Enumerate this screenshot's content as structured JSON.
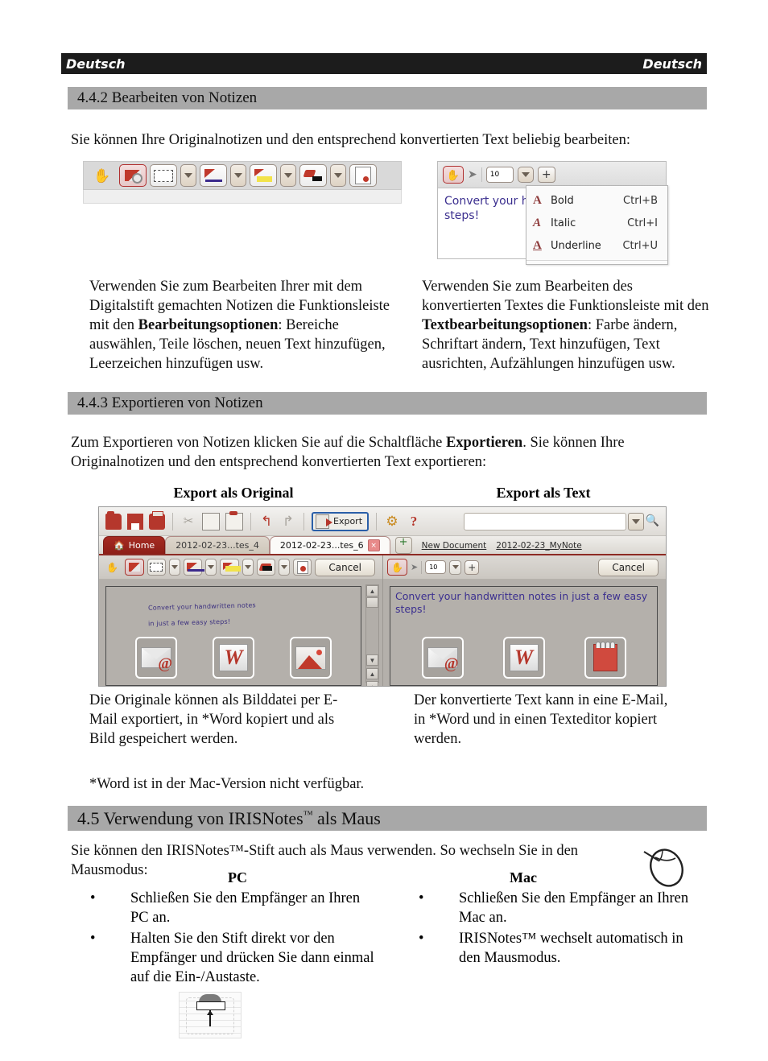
{
  "header": {
    "left": "Deutsch",
    "right": "Deutsch"
  },
  "sections": {
    "s442": {
      "heading": "4.4.2 Bearbeiten von Notizen"
    },
    "s443": {
      "heading": "4.4.3 Exportieren von Notizen"
    },
    "s45": {
      "heading_pre": "4.5 Verwendung von IRISNotes",
      "heading_tm": "™",
      "heading_post": " als Maus"
    }
  },
  "body": {
    "intro_442": "Sie können Ihre Originalnotizen und den entsprechend konvertierten Text beliebig bearbeiten:",
    "left_442": {
      "part1": "Verwenden Sie zum Bearbeiten Ihrer mit dem Digitalstift gemachten Notizen die Funktionsleiste mit den ",
      "bold": "Bearbeitungsoptionen",
      "part2": ": Bereiche auswählen, Teile löschen, neuen Text hinzufügen, Leerzeichen hinzufügen usw."
    },
    "right_442": {
      "part1": "Verwenden Sie zum Bearbeiten des konvertierten Textes die Funktionsleiste mit den ",
      "bold": "Textbearbeitungsoptionen",
      "part2": ": Farbe ändern, Schriftart ändern, Text hinzufügen, Text ausrichten, Aufzählungen hinzufügen usw."
    },
    "intro_443": {
      "part1": "Zum Exportieren von Notizen klicken Sie auf die Schaltfläche ",
      "bold": "Exportieren",
      "part2": ". Sie können Ihre Originalnotizen und den entsprechend konvertierten Text exportieren:"
    },
    "caption_left": "Export als Original",
    "caption_right": "Export als Text",
    "left_443": "Die Originale können als Bilddatei per E-Mail exportiert, in *Word kopiert und als Bild gespeichert werden.",
    "footnote_443": "*Word ist in der Mac-Version nicht verfügbar.",
    "right_443": "Der konvertierte Text kann in eine E-Mail, in *Word und in einen Texteditor kopiert werden.",
    "intro_45": "Sie können den IRISNotes™-Stift auch als Maus verwenden. So wechseln Sie in den Mausmodus:"
  },
  "columns": {
    "pc": {
      "title": "PC",
      "bullet_char": "•",
      "items": [
        "Schließen Sie den Empfänger an Ihren PC an.",
        "Halten Sie den Stift direkt vor den Empfänger und drücken Sie dann einmal auf die Ein-/Austaste."
      ]
    },
    "mac": {
      "title": "Mac",
      "bullet_char": "•",
      "items": [
        "Schließen Sie den Empfänger an Ihren Mac an.",
        "IRISNotes™ wechselt automatisch in den Mausmodus."
      ]
    }
  },
  "figures": {
    "edit_toolbar": {
      "buttons": [
        {
          "icon": "hand-icon",
          "label": ""
        },
        {
          "icon": "settings-area-icon",
          "label": ""
        },
        {
          "icon": "select-rect-icon",
          "label": ""
        },
        {
          "icon": "dropdown-caret-icon",
          "label": ""
        },
        {
          "icon": "pen-icon",
          "label": ""
        },
        {
          "icon": "dropdown-caret-icon",
          "label": ""
        },
        {
          "icon": "highlighter-icon",
          "label": ""
        },
        {
          "icon": "dropdown-caret-icon",
          "label": ""
        },
        {
          "icon": "eraser-icon",
          "label": ""
        },
        {
          "icon": "dropdown-caret-icon",
          "label": ""
        },
        {
          "icon": "note-edit-icon",
          "label": ""
        }
      ]
    },
    "text_toolbar": {
      "font_size_value": "10",
      "plus_label": "+",
      "sample_text_line1": "Convert your h",
      "sample_text_line2": "steps!",
      "menu": [
        {
          "glyph": "A",
          "label": "Bold",
          "shortcut": "Ctrl+B"
        },
        {
          "glyph": "A",
          "label": "Italic",
          "shortcut": "Ctrl+I"
        },
        {
          "glyph": "A",
          "label": "Underline",
          "shortcut": "Ctrl+U"
        }
      ]
    },
    "app": {
      "toolbar": {
        "export_label": "Export",
        "icons": [
          "open-folder-icon",
          "save-icon",
          "print-icon",
          "cut-icon",
          "copy-icon",
          "paste-icon",
          "undo-icon",
          "redo-icon",
          "settings-gear-icon",
          "help-icon"
        ]
      },
      "tabs": [
        {
          "label": "Home",
          "state": "home"
        },
        {
          "label": "2012-02-23...tes_4",
          "state": "inactive"
        },
        {
          "label": "2012-02-23...tes_6",
          "state": "active",
          "close": "×"
        }
      ],
      "search": {
        "value": "",
        "placeholder": ""
      },
      "doc_links": [
        "New Document",
        "2012-02-23_MyNote"
      ],
      "left_panel": {
        "cancel_label": "Cancel",
        "handwriting_line1": "Convert your handwritten notes",
        "handwriting_line2": "in just a few easy steps!",
        "export_icons": [
          "email-export-icon",
          "word-export-icon",
          "image-export-icon"
        ]
      },
      "right_panel": {
        "cancel_label": "Cancel",
        "font_size_value": "10",
        "plus_label": "+",
        "converted_text": "Convert your handwritten notes in just a few easy steps!",
        "export_icons": [
          "email-export-icon",
          "word-export-icon",
          "notepad-export-icon"
        ]
      }
    },
    "receiver": {
      "icon": "receiver-power-button-icon"
    },
    "mouse": {
      "icon": "computer-mouse-icon"
    }
  },
  "colors": {
    "header_bg": "#1c1c1c",
    "section_bar": "#a8a8a8",
    "accent_red": "#b5372c",
    "ink_blue": "#3b2f8f",
    "export_focus": "#2a5fa8"
  }
}
